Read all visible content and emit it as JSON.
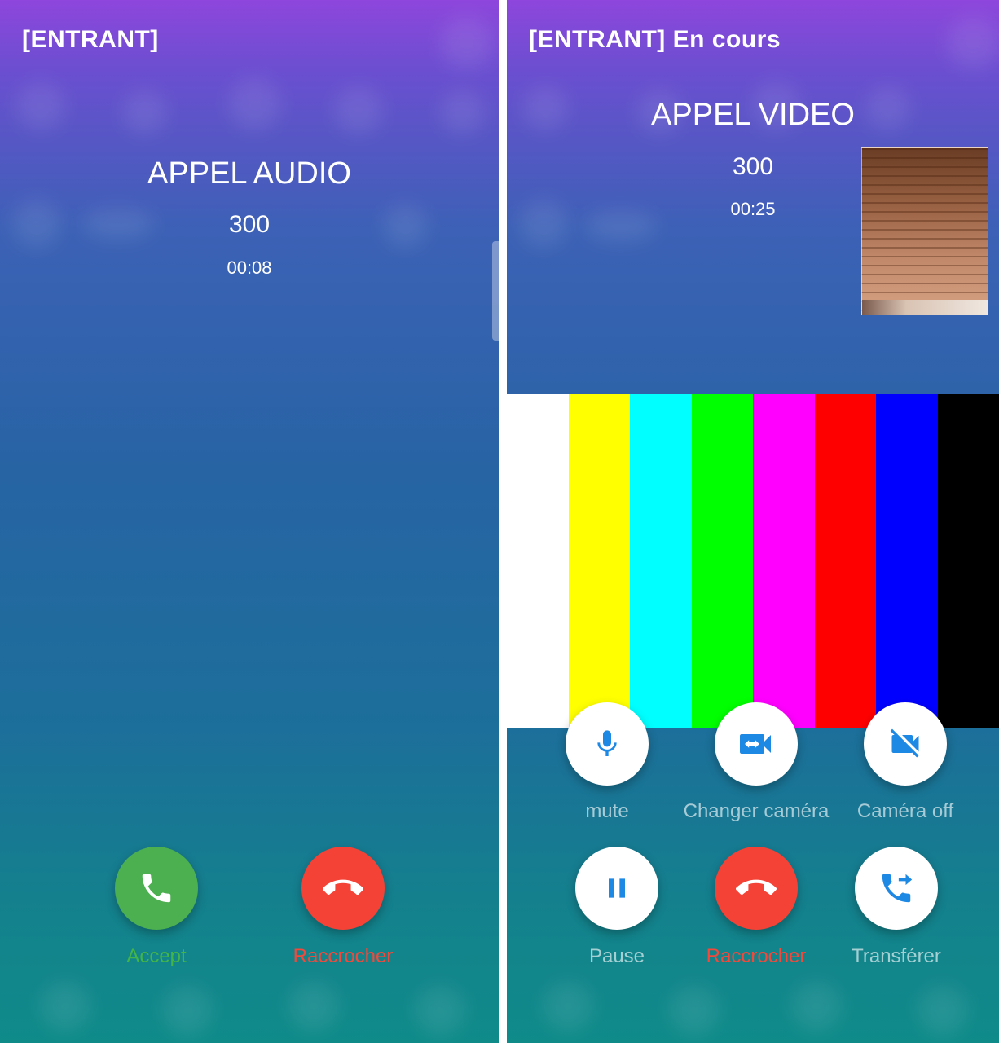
{
  "incoming_audio": {
    "status": "[ENTRANT]",
    "call_type": "APPEL AUDIO",
    "caller_number": "300",
    "duration": "00:08",
    "accept_label": "Accept",
    "hangup_label": "Raccrocher",
    "accept_icon": "phone-icon",
    "hangup_icon": "phone-hangup-icon",
    "accept_color": "#4caf50",
    "hangup_color": "#f44336"
  },
  "ongoing_video": {
    "status": "[ENTRANT] En cours",
    "call_type": "APPEL VIDEO",
    "caller_number": "300",
    "duration": "00:25",
    "controls": {
      "mute_label": "mute",
      "switch_camera_label": "Changer caméra",
      "camera_off_label": "Caméra off",
      "pause_label": "Pause",
      "hangup_label": "Raccrocher",
      "transfer_label": "Transférer"
    },
    "icons": {
      "mute": "microphone-icon",
      "switch_camera": "switch-camera-icon",
      "camera_off": "video-off-icon",
      "pause": "pause-icon",
      "hangup": "phone-hangup-icon",
      "transfer": "call-transfer-icon"
    },
    "accent_color": "#1e88e5",
    "test_pattern_colors": [
      "#ffffff",
      "#ffff00",
      "#00ffff",
      "#00ff00",
      "#ff00ff",
      "#ff0000",
      "#0000ff",
      "#000000"
    ]
  }
}
